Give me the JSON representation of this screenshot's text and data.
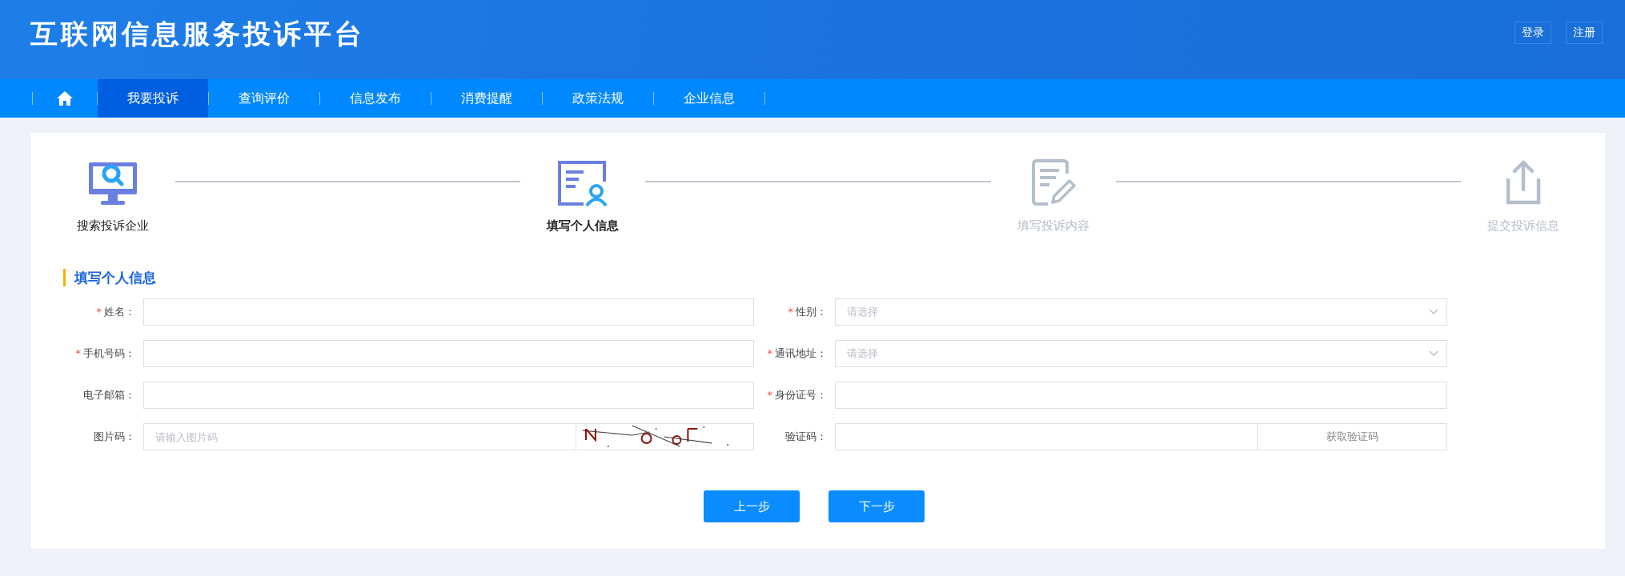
{
  "header": {
    "title": "互联网信息服务投诉平台",
    "links": [
      "登录",
      "注册"
    ]
  },
  "nav": {
    "items": [
      {
        "label": "我要投诉",
        "selected": true
      },
      {
        "label": "查询评价",
        "selected": false
      },
      {
        "label": "信息发布",
        "selected": false
      },
      {
        "label": "消费提醒",
        "selected": false
      },
      {
        "label": "政策法规",
        "selected": false
      },
      {
        "label": "企业信息",
        "selected": false
      }
    ]
  },
  "steps": [
    {
      "label": "搜索投诉企业",
      "kind": "search",
      "reached": true,
      "current": false
    },
    {
      "label": "填写个人信息",
      "kind": "person",
      "reached": true,
      "current": true
    },
    {
      "label": "填写投诉内容",
      "kind": "edit",
      "reached": false,
      "current": false
    },
    {
      "label": "提交投诉信息",
      "kind": "upload",
      "reached": false,
      "current": false
    }
  ],
  "form": {
    "title": "填写个人信息",
    "fields": [
      {
        "label": "姓名：",
        "required_mark": "*",
        "kind": "input"
      },
      {
        "label": "性别：",
        "required_mark": "*",
        "kind": "select",
        "placeholder": "请选择"
      },
      {
        "label": "手机号码：",
        "required_mark": "*",
        "kind": "input"
      },
      {
        "label": "通讯地址：",
        "required_mark": "*",
        "kind": "select",
        "placeholder": "请选择"
      },
      {
        "label": "电子邮箱：",
        "kind": "input"
      },
      {
        "label": "身份证号：",
        "required_mark": "*",
        "kind": "input"
      },
      {
        "label": "图片码：",
        "kind": "captcha",
        "placeholder": "请输入图片码"
      },
      {
        "label": "验证码：",
        "kind": "sms",
        "button": "获取验证码"
      }
    ]
  },
  "buttons": [
    "上一步",
    "下一步"
  ]
}
